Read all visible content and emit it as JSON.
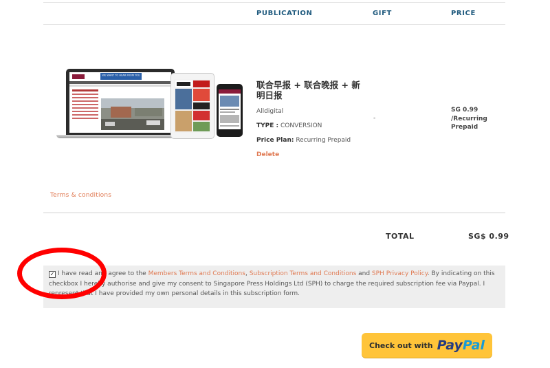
{
  "table": {
    "headers": {
      "publication": "PUBLICATION",
      "gift": "GIFT",
      "price": "PRICE"
    }
  },
  "item": {
    "title": "联合早报 + 联合晚报 + 新明日报",
    "subtitle": "Alldigital",
    "type_label": "TYPE :",
    "type_value": "CONVERSION",
    "plan_label": "Price Plan:",
    "plan_value": "Recurring Prepaid",
    "delete_label": "Delete",
    "gift_value": "-",
    "price_value": "SG 0.99 /Recurring Prepaid"
  },
  "device_images": {
    "laptop_banner": "WE WANT TO HEAR FROM YOU"
  },
  "terms_link": "Terms & conditions",
  "total": {
    "label": "TOTAL",
    "value": "SG$ 0.99"
  },
  "consent": {
    "checked": true,
    "text_1": "I have read and agree to the ",
    "link_1": "Members Terms and Conditions",
    "text_2": ", ",
    "link_2": "Subscription Terms and Conditions",
    "text_3": " and ",
    "link_3": "SPH Privacy Policy",
    "text_4": ". By indicating on this checkbox I hereby authorise and give my consent to Singapore Press Holdings Ltd (SPH) to charge the required subscription fee via Paypal. I represent that I have provided my own personal details in this subscription form."
  },
  "checkout": {
    "prefix": "Check out with",
    "brand_1": "Pay",
    "brand_2": "Pal"
  },
  "colors": {
    "header_text": "#1f5a7e",
    "link_orange": "#e07a53",
    "consent_bg": "#eeeeee",
    "annotation_red": "#ff0000",
    "paypal_yellow": "#ffc439"
  }
}
